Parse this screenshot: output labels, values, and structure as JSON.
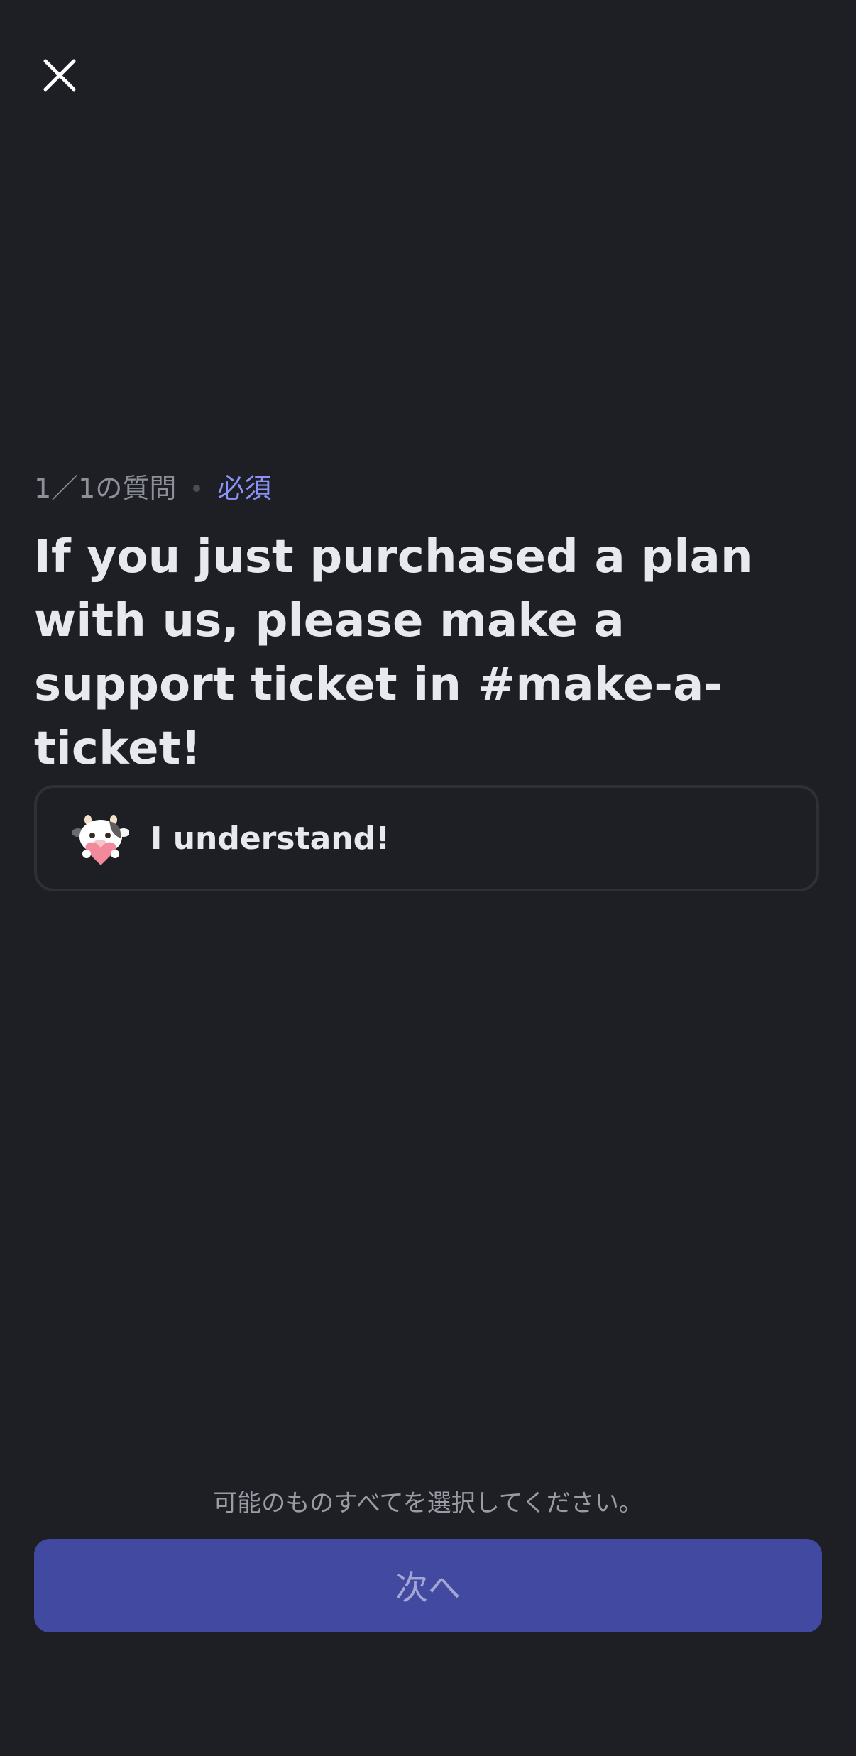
{
  "header": {
    "close_icon": "close-icon"
  },
  "question": {
    "count": "1／1の質問",
    "required": "必須",
    "text": "If you just purchased a plan with us, please make a support ticket in #make-a-ticket!"
  },
  "options": [
    {
      "icon": "cow-heart-emoji-icon",
      "label": "I understand!"
    }
  ],
  "footer": {
    "hint": "可能のものすべてを選択してください。",
    "next_label": "次へ"
  },
  "colors": {
    "background": "#1e1f24",
    "accent": "#8b93f8",
    "button": "#4249a0"
  }
}
